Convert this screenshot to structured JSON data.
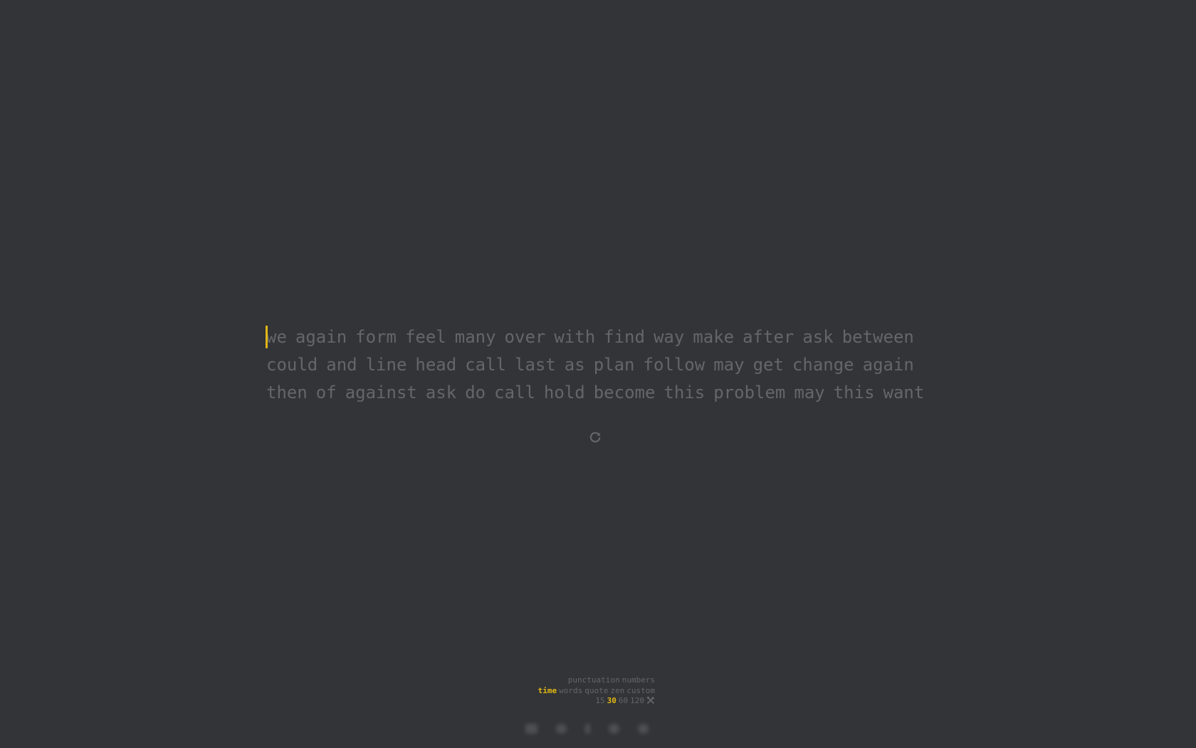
{
  "test": {
    "lines": [
      [
        "we",
        "again",
        "form",
        "feel",
        "many",
        "over",
        "with",
        "find",
        "way",
        "make",
        "after",
        "ask",
        "between"
      ],
      [
        "could",
        "and",
        "line",
        "head",
        "call",
        "last",
        "as",
        "plan",
        "follow",
        "may",
        "get",
        "change",
        "again"
      ],
      [
        "then",
        "of",
        "against",
        "ask",
        "do",
        "call",
        "hold",
        "become",
        "this",
        "problem",
        "may",
        "this",
        "want"
      ]
    ]
  },
  "restart_icon": "restart-icon",
  "config": {
    "modifiers": [
      "punctuation",
      "numbers"
    ],
    "modes": [
      "time",
      "words",
      "quote",
      "zen",
      "custom"
    ],
    "active_mode": "time",
    "durations": [
      "15",
      "30",
      "60",
      "120"
    ],
    "active_duration": "30",
    "custom_icon": "tools-icon"
  },
  "footer_icons": [
    "keyboard-icon",
    "home-icon",
    "info-icon",
    "settings-icon",
    "user-icon"
  ],
  "colors": {
    "background": "#323437",
    "text": "#646669",
    "accent": "#e2b714"
  }
}
